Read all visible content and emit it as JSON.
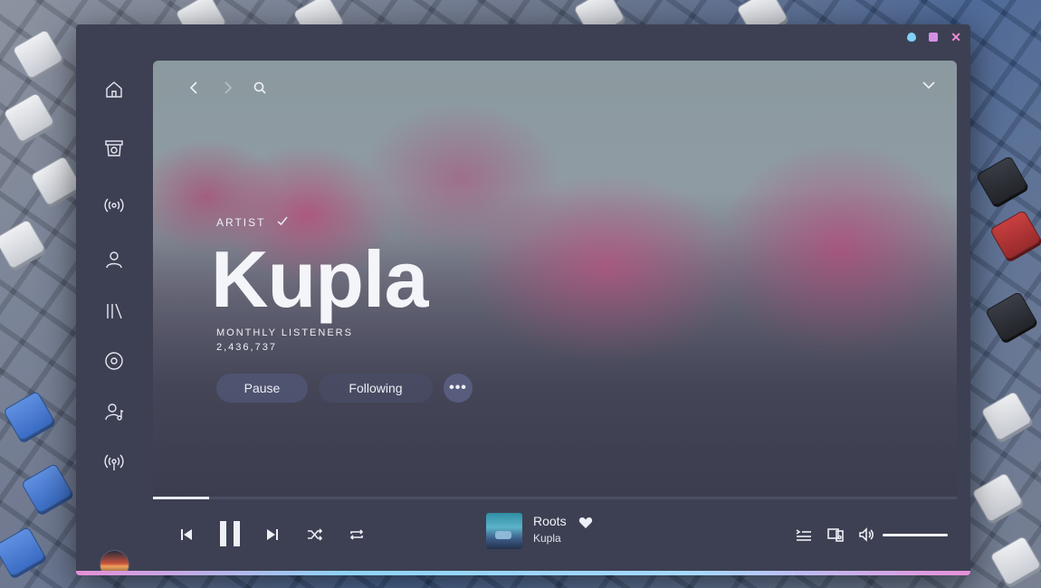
{
  "window": {
    "controls": [
      "drop-icon",
      "square-icon",
      "close-icon"
    ],
    "close_glyph": "✕"
  },
  "sidebar": {
    "items": [
      {
        "name": "home",
        "icon": "home-icon"
      },
      {
        "name": "browse",
        "icon": "basket-icon"
      },
      {
        "name": "radio",
        "icon": "radio-icon"
      },
      {
        "name": "profile",
        "icon": "user-icon"
      },
      {
        "name": "library",
        "icon": "library-icon"
      },
      {
        "name": "albums",
        "icon": "disc-icon"
      },
      {
        "name": "artists",
        "icon": "artist-icon"
      },
      {
        "name": "podcasts",
        "icon": "podcast-icon"
      }
    ],
    "avatar": "user-avatar"
  },
  "artist": {
    "label": "ARTIST",
    "name": "Kupla",
    "listeners_label": "MONTHLY LISTENERS",
    "listeners_value": "2,436,737",
    "pause_label": "Pause",
    "following_label": "Following",
    "more_label": "•••"
  },
  "player": {
    "progress": 0.07,
    "track_title": "Roots",
    "track_artist": "Kupla",
    "volume": 1.0,
    "liked": true
  },
  "colors": {
    "window_bg": "#3d4052",
    "accent_pink": "#f08ad8",
    "accent_blue": "#7fd1f5"
  }
}
